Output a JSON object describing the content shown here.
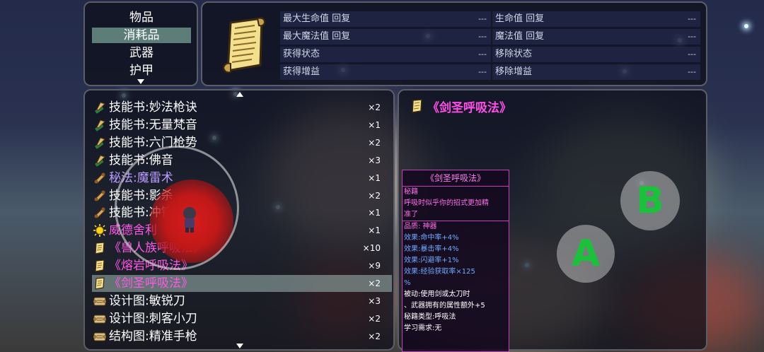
{
  "categories": {
    "items": [
      {
        "label": "物品"
      },
      {
        "label": "消耗品"
      },
      {
        "label": "武器"
      },
      {
        "label": "护甲"
      }
    ],
    "selected": "消耗品"
  },
  "stats": {
    "rows": [
      {
        "label": "最大生命值 回复",
        "value": "---"
      },
      {
        "label": "生命值 回复",
        "value": "---"
      },
      {
        "label": "最大魔法值 回复",
        "value": "---"
      },
      {
        "label": "魔法值 回复",
        "value": "---"
      },
      {
        "label": "获得状态",
        "value": "---"
      },
      {
        "label": "移除状态",
        "value": "---"
      },
      {
        "label": "获得增益",
        "value": "---"
      },
      {
        "label": "移除增益",
        "value": "---"
      }
    ]
  },
  "item_list": {
    "items": [
      {
        "name": "技能书:妙法枪诀",
        "count": "×2",
        "color": "#ffffff",
        "icon": "quill-book-icon"
      },
      {
        "name": "技能书:无量梵音",
        "count": "×1",
        "color": "#ffffff",
        "icon": "quill-book-icon"
      },
      {
        "name": "技能书:六门枪势",
        "count": "×2",
        "color": "#ffffff",
        "icon": "quill-book-icon"
      },
      {
        "name": "技能书:佛音",
        "count": "×3",
        "color": "#ffffff",
        "icon": "quill-book-icon"
      },
      {
        "name": "秘法:魔雷术",
        "count": "×1",
        "color": "#b99cff",
        "icon": "scroll-roll-icon"
      },
      {
        "name": "技能书:影杀",
        "count": "×2",
        "color": "#ffffff",
        "icon": "scroll-roll-icon"
      },
      {
        "name": "技能书:冲锋",
        "count": "×1",
        "color": "#ffffff",
        "icon": "scroll-roll-icon"
      },
      {
        "name": "威德舍利",
        "count": "×1",
        "color": "#ff58e6",
        "icon": "sun-relic-icon"
      },
      {
        "name": "《兽人族呼吸法》",
        "count": "×10",
        "color": "#ff58e6",
        "icon": "parchment-icon"
      },
      {
        "name": "《熔岩呼吸法》",
        "count": "×9",
        "color": "#ff58e6",
        "icon": "parchment-icon"
      },
      {
        "name": "《剑圣呼吸法》",
        "count": "×2",
        "color": "#ff58e6",
        "icon": "parchment-icon"
      },
      {
        "name": "设计图:敏锐刀",
        "count": "×3",
        "color": "#ffffff",
        "icon": "blueprint-icon"
      },
      {
        "name": "设计图:刺客小刀",
        "count": "×2",
        "color": "#ffffff",
        "icon": "blueprint-icon"
      },
      {
        "name": "结构图:精准手枪",
        "count": "×2",
        "color": "#ffffff",
        "icon": "blueprint-icon"
      }
    ],
    "selected_index": 10
  },
  "detail": {
    "title": "《剑圣呼吸法》",
    "tooltip": {
      "title": "《剑圣呼吸法》",
      "category": "秘籍",
      "description_1": "呼吸时似乎你的招式更加精",
      "description_2": "准了",
      "quality": "品质: 神器",
      "effect_1": "效果:命中率+4%",
      "effect_2": "效果:暴击率+4%",
      "effect_3": "效果:闪避率+1%",
      "effect_4": "效果:经验获取率×125",
      "effect_4b": "%",
      "passive_1": "被动:使用剑或太刀时",
      "passive_2": "、武器拥有的属性额外+5",
      "book_type": "秘籍类型:呼吸法",
      "requirement": "学习需求:无"
    }
  },
  "controls": {
    "button_a": "A",
    "button_b": "B"
  }
}
